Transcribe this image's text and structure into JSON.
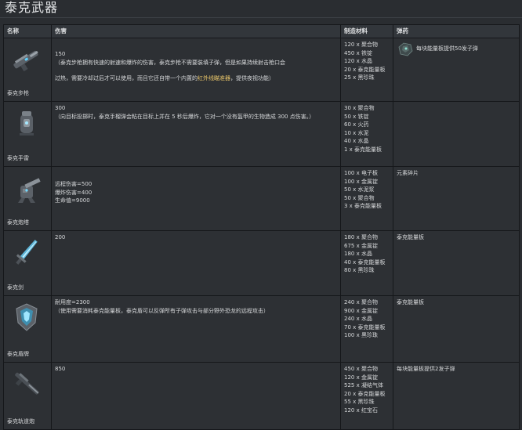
{
  "page": {
    "title": "泰克武器"
  },
  "table": {
    "headers": {
      "name": "名称",
      "damage": "伤害",
      "materials": "制造材料",
      "ammo": "弹药"
    },
    "rows": [
      {
        "name": "泰克步枪",
        "icon": "rifle-icon",
        "damage_lines": [
          "150",
          "（泰克步枪拥有快速的射速和爆炸的伤害，泰克步枪不需要装填子弹，但是如果持续射击枪口会"
        ],
        "damage_gap_before": "过热，需要冷却过后才可以使用，而且它还自带一个内置的",
        "damage_highlight": "红外线瞄准器",
        "damage_gap_after": "，提供夜视功能）",
        "materials": [
          "120 x 聚合物",
          "450 x 铁锭",
          "120 x 水晶",
          "20 x 泰克能量板",
          "25 x 黑珍珠"
        ],
        "ammo": "每块能量板提供50发子弹",
        "ammo_icon": "element-shard-icon"
      },
      {
        "name": "泰克手雷",
        "icon": "grenade-icon",
        "damage_lines": [
          "300",
          "（向目标投掷时，泰克手榴弹会粘在目标上并在 5 秒后爆炸，它对一个没有盔甲的生物造成 300 点伤害。）"
        ],
        "materials": [
          "30 x 聚合物",
          "50 x 铁锭",
          "60 x 火药",
          "10 x 水泥",
          "40 x 水晶",
          "1 x 泰克能量板"
        ],
        "ammo": ""
      },
      {
        "name": "泰克炮塔",
        "icon": "turret-icon",
        "damage_lines": [
          "远程伤害=500",
          "爆炸伤害=400",
          "生命值=9000"
        ],
        "materials": [
          "100 x 电子板",
          "100 x 金属锭",
          "50 x 水泥浆",
          "50 x 聚合物",
          "3 x 泰克能量板"
        ],
        "ammo": "元素碎片"
      },
      {
        "name": "泰克剑",
        "icon": "sword-icon",
        "damage_lines": [
          "200"
        ],
        "materials": [
          "180 x 聚合物",
          "675 x 金属锭",
          "180 x 水晶",
          "40 x 泰克能量板",
          "80 x 黑珍珠"
        ],
        "ammo": "泰克能量板"
      },
      {
        "name": "泰克盾牌",
        "icon": "shield-icon",
        "damage_lines": [
          "耐用度=2300",
          "（使用需要消耗泰克能量板，泰克盾可以反弹所有子弹攻击与部分野外恐龙的远程攻击）"
        ],
        "materials": [
          "240 x 聚合物",
          "900 x 金属锭",
          "240 x 水晶",
          "70 x 泰克能量板",
          "100 x 黑珍珠"
        ],
        "ammo": "泰克能量板"
      },
      {
        "name": "泰克轨道炮",
        "icon": "railgun-icon",
        "damage_lines": [
          "850"
        ],
        "materials": [
          "450 x 聚合物",
          "120 x 金属锭",
          "525 x 凝结气体",
          "20 x 泰克能量板",
          "55 x 黑珍珠",
          "120 x 红宝石"
        ],
        "ammo": "每块能量板提供2发子弹"
      }
    ]
  }
}
